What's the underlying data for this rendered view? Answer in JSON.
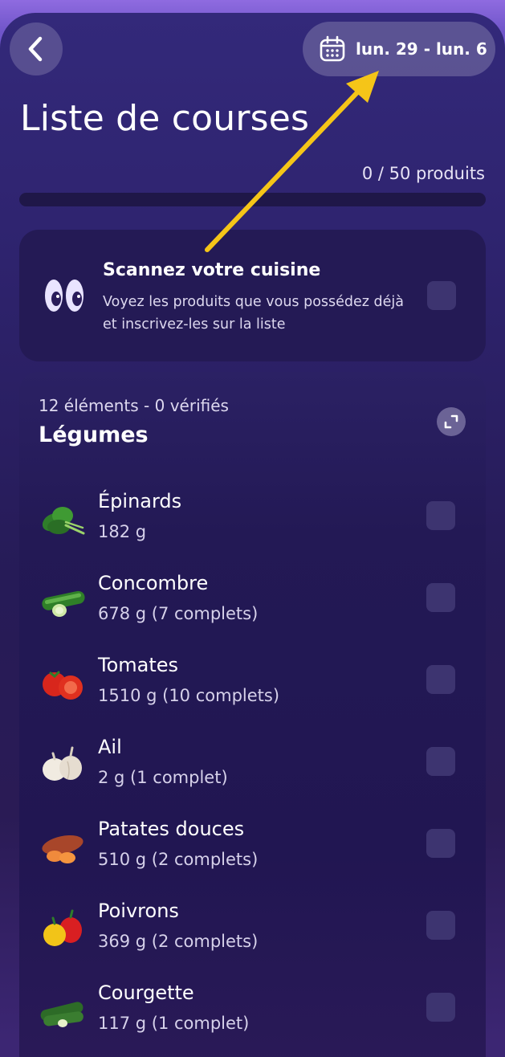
{
  "header": {
    "date_range": "lun. 29 - lun. 6",
    "title": "Liste de courses"
  },
  "progress": {
    "text": "0 / 50 produits",
    "checked": 0,
    "total": 50
  },
  "scan_card": {
    "title": "Scannez votre cuisine",
    "description": "Voyez les produits que vous possédez déjà et inscrivez-les sur la liste",
    "icon": "eyes-icon",
    "checked": false
  },
  "list": {
    "meta": "12 éléments - 0 vérifiés",
    "category": "Légumes",
    "items": [
      {
        "name": "Épinards",
        "qty": "182 g",
        "icon": "spinach-icon",
        "checked": false
      },
      {
        "name": "Concombre",
        "qty": "678 g  (7 complets)",
        "icon": "cucumber-icon",
        "checked": false
      },
      {
        "name": "Tomates",
        "qty": "1510 g  (10 complets)",
        "icon": "tomato-icon",
        "checked": false
      },
      {
        "name": "Ail",
        "qty": "2 g  (1 complet)",
        "icon": "garlic-icon",
        "checked": false
      },
      {
        "name": "Patates douces",
        "qty": "510 g  (2 complets)",
        "icon": "sweet-potato-icon",
        "checked": false
      },
      {
        "name": "Poivrons",
        "qty": "369 g  (2 complets)",
        "icon": "bell-pepper-icon",
        "checked": false
      },
      {
        "name": "Courgette",
        "qty": "117 g  (1 complet)",
        "icon": "zucchini-icon",
        "checked": false
      }
    ]
  },
  "colors": {
    "accent_arrow": "#f5c518",
    "checkbox": "#3d3470"
  }
}
